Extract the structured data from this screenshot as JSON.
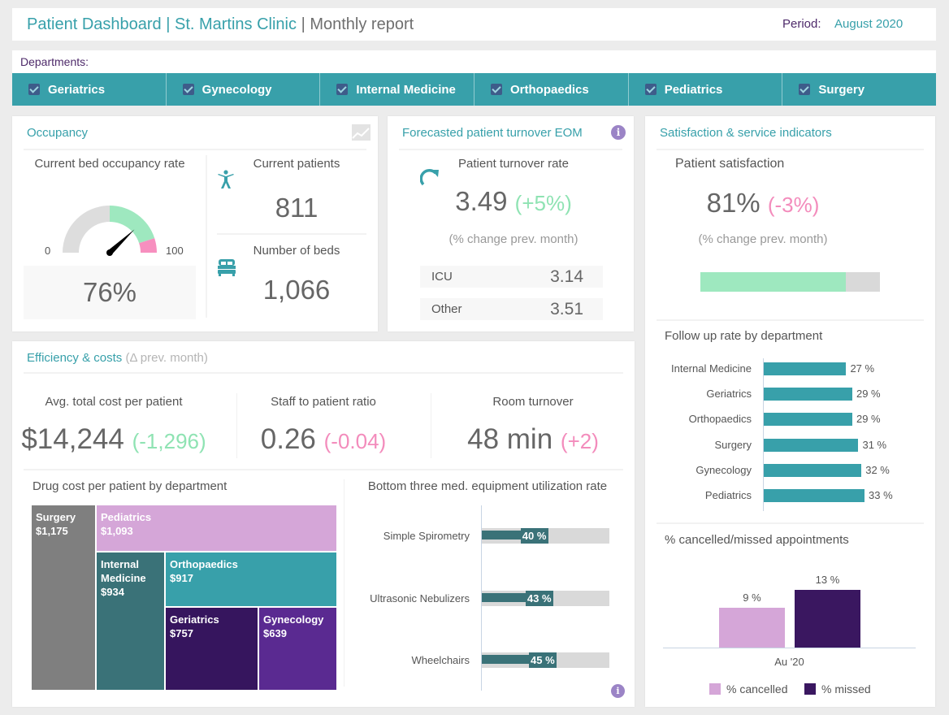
{
  "header": {
    "title_main": "Patient Dashboard | St. Martins Clinic",
    "title_sep": " | ",
    "title_sub": "Monthly report",
    "period_label": "Period:",
    "period_value": "August 2020"
  },
  "departments": {
    "label": "Departments:",
    "items": [
      {
        "label": "Geriatrics",
        "checked": true
      },
      {
        "label": "Gynecology",
        "checked": true
      },
      {
        "label": "Internal Medicine",
        "checked": true
      },
      {
        "label": "Orthopaedics",
        "checked": true
      },
      {
        "label": "Pediatrics",
        "checked": true
      },
      {
        "label": "Surgery",
        "checked": true
      }
    ]
  },
  "occupancy": {
    "title": "Occupancy",
    "icon": "line-chart-icon",
    "rate_label": "Current bed occupancy rate",
    "gauge": {
      "min": "0",
      "max": "100",
      "value": 76,
      "green_from": 50,
      "red_from": 90,
      "colors": {
        "base": "#dddddd",
        "good": "#9ee8bf",
        "bad": "#f78fbf"
      }
    },
    "rate_value": "76%",
    "current_patients_label": "Current patients",
    "current_patients_value": "811",
    "beds_label": "Number of beds",
    "beds_value": "1,066"
  },
  "turnover": {
    "title": "Forecasted patient turnover EOM",
    "rate_label": "Patient turnover rate",
    "rate_value": "3.49",
    "rate_change": "(+5%)",
    "note": "(% change prev. month)",
    "rows": [
      {
        "label": "ICU",
        "value": "3.14"
      },
      {
        "label": "Other",
        "value": "3.51"
      }
    ]
  },
  "satisfaction": {
    "title": "Satisfaction & service indicators",
    "label": "Patient satisfaction",
    "value": "81%",
    "change": "(-3%)",
    "note": "(% change prev. month)",
    "bar_fraction": 0.81,
    "followup": {
      "title": "Follow up rate by department",
      "items": [
        {
          "label": "Internal Medicine",
          "value": 27,
          "text": "27 %"
        },
        {
          "label": "Geriatrics",
          "value": 29,
          "text": "29 %"
        },
        {
          "label": "Orthopaedics",
          "value": 29,
          "text": "29 %"
        },
        {
          "label": "Surgery",
          "value": 31,
          "text": "31 %"
        },
        {
          "label": "Gynecology",
          "value": 32,
          "text": "32 %"
        },
        {
          "label": "Pediatrics",
          "value": 33,
          "text": "33 %"
        }
      ]
    },
    "cancelled": {
      "title": "% cancelled/missed appointments",
      "category": "Au '20",
      "series": [
        {
          "name": "% cancelled",
          "value": 9,
          "text": "9 %",
          "color": "#d5a6d8"
        },
        {
          "name": "% missed",
          "value": 13,
          "text": "13 %",
          "color": "#3a1760"
        }
      ]
    }
  },
  "efficiency": {
    "title": "Efficiency & costs",
    "title_sub": "(Δ prev. month)",
    "kpis": [
      {
        "label": "Avg. total cost per patient",
        "value": "$14,244",
        "change": "(-1,296)",
        "trend": "pos"
      },
      {
        "label": "Staff to patient ratio",
        "value": "0.26",
        "change": "(-0.04)",
        "trend": "neg"
      },
      {
        "label": "Room turnover",
        "value": "48 min",
        "change": "(+2)",
        "trend": "neg"
      }
    ],
    "treemap": {
      "title": "Drug cost per patient by department",
      "cells": [
        {
          "label": "Surgery",
          "value": "$1,175",
          "color": "#7f7f7f"
        },
        {
          "label": "Pediatrics",
          "value": "$1,093",
          "color": "#d5a6d8"
        },
        {
          "label": "Internal Medicine",
          "value": "$934",
          "color": "#3a7278"
        },
        {
          "label": "Orthopaedics",
          "value": "$917",
          "color": "#38a0aa"
        },
        {
          "label": "Geriatrics",
          "value": "$757",
          "color": "#36155e"
        },
        {
          "label": "Gynecology",
          "value": "$639",
          "color": "#5a2a91"
        }
      ]
    },
    "equipment": {
      "title": "Bottom three med. equipment utilization rate",
      "items": [
        {
          "label": "Simple Spirometry",
          "value": 40,
          "text": "40 %"
        },
        {
          "label": "Ultrasonic Nebulizers",
          "value": 43,
          "text": "43 %"
        },
        {
          "label": "Wheelchairs",
          "value": 45,
          "text": "45 %"
        }
      ]
    }
  },
  "chart_data": [
    {
      "type": "bar",
      "title": "Follow up rate by department",
      "orientation": "horizontal",
      "categories": [
        "Internal Medicine",
        "Geriatrics",
        "Orthopaedics",
        "Surgery",
        "Gynecology",
        "Pediatrics"
      ],
      "values": [
        27,
        29,
        29,
        31,
        32,
        33
      ],
      "unit": "%"
    },
    {
      "type": "bar",
      "title": "% cancelled/missed appointments",
      "categories": [
        "Au '20"
      ],
      "series": [
        {
          "name": "% cancelled",
          "values": [
            9
          ]
        },
        {
          "name": "% missed",
          "values": [
            13
          ]
        }
      ],
      "legend": "bottom",
      "unit": "%"
    },
    {
      "type": "bar",
      "title": "Bottom three med. equipment utilization rate",
      "orientation": "horizontal",
      "categories": [
        "Simple Spirometry",
        "Ultrasonic Nebulizers",
        "Wheelchairs"
      ],
      "values": [
        40,
        43,
        45
      ],
      "xlim": [
        0,
        100
      ],
      "unit": "%"
    },
    {
      "type": "treemap",
      "title": "Drug cost per patient by department",
      "categories": [
        "Surgery",
        "Pediatrics",
        "Internal Medicine",
        "Orthopaedics",
        "Geriatrics",
        "Gynecology"
      ],
      "values": [
        1175,
        1093,
        934,
        917,
        757,
        639
      ],
      "unit": "$"
    },
    {
      "type": "gauge",
      "title": "Current bed occupancy rate",
      "value": 76,
      "range": [
        0,
        100
      ]
    }
  ]
}
